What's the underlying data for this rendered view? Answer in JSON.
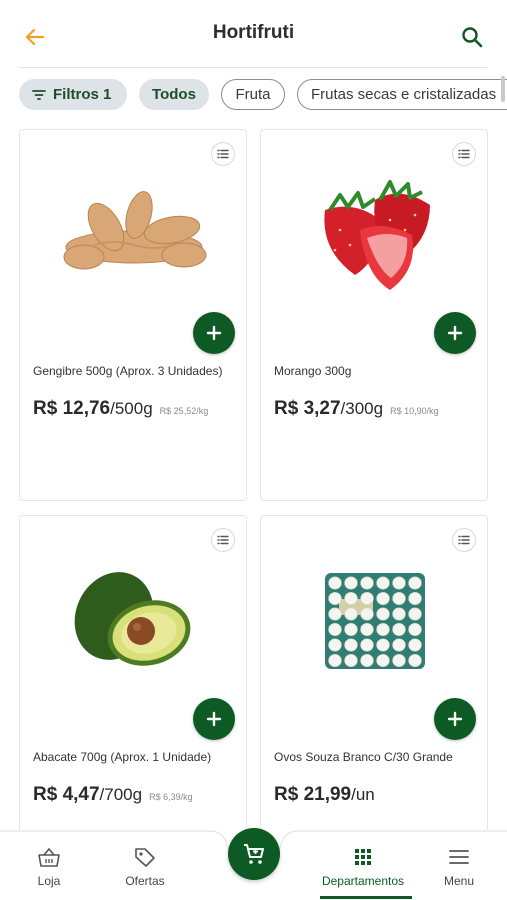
{
  "header": {
    "title": "Hortifruti",
    "back_icon": "arrow-left-icon",
    "search_icon": "search-icon"
  },
  "colors": {
    "accent_green": "#0e5a25",
    "back_arrow": "#f0a020",
    "chip_filled_bg": "#dde3e7"
  },
  "chips": {
    "filters_label": "Filtros",
    "filters_count": "1",
    "items": [
      {
        "label": "Todos",
        "selected": true
      },
      {
        "label": "Fruta",
        "selected": false
      },
      {
        "label": "Frutas secas e cristalizadas",
        "selected": false
      }
    ]
  },
  "products": [
    {
      "name": "Gengibre 500g (Aprox. 3 Unidades)",
      "price": "R$ 12,76",
      "unit": "/500g",
      "per_kg": "R$ 25,52/kg",
      "image": "ginger"
    },
    {
      "name": "Morango 300g",
      "price": "R$ 3,27",
      "unit": "/300g",
      "per_kg": "R$ 10,90/kg",
      "image": "strawberry"
    },
    {
      "name": "Abacate 700g (Aprox. 1 Unidade)",
      "price": "R$ 4,47",
      "unit": "/700g",
      "per_kg": "R$ 6,39/kg",
      "image": "avocado"
    },
    {
      "name": "Ovos Souza Branco C/30 Grande",
      "price": "R$ 21,99",
      "unit": "/un",
      "per_kg": "",
      "image": "eggs"
    }
  ],
  "bottom_nav": {
    "items": [
      {
        "label": "Loja",
        "icon": "basket-icon"
      },
      {
        "label": "Ofertas",
        "icon": "tag-icon"
      },
      {
        "label": "Departamentos",
        "icon": "grid-icon",
        "active": true
      },
      {
        "label": "Menu",
        "icon": "menu-icon"
      }
    ],
    "cart_icon": "cart-icon"
  }
}
